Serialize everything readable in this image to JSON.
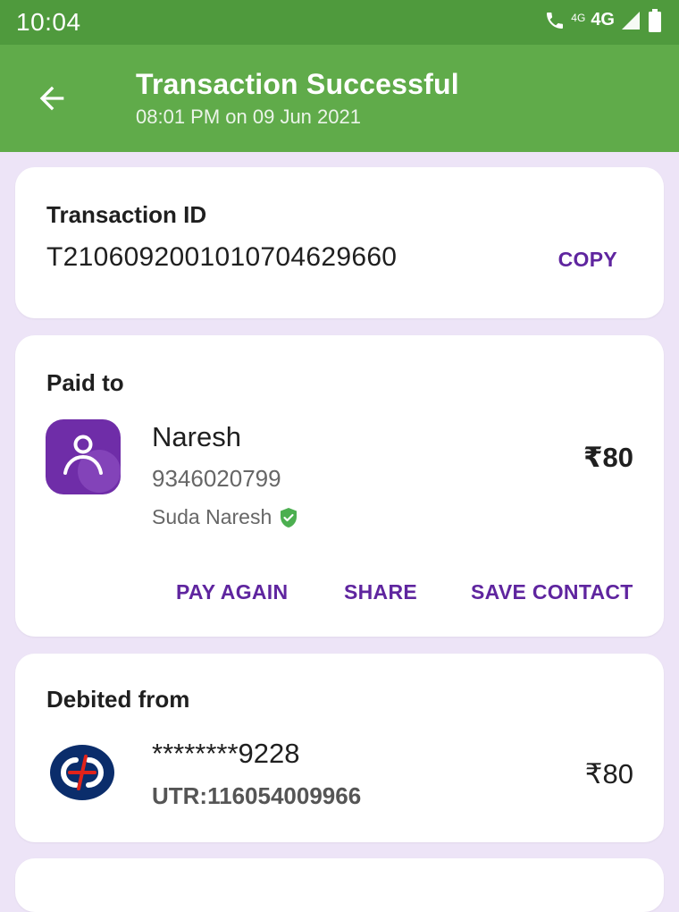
{
  "status_bar": {
    "time": "10:04",
    "network_small": "4G",
    "network": "4G"
  },
  "app_bar": {
    "title": "Transaction Successful",
    "subtitle": "08:01 PM on 09 Jun 2021"
  },
  "transaction": {
    "label": "Transaction ID",
    "id": "T2106092001010704629660",
    "copy_label": "COPY"
  },
  "paid_to": {
    "label": "Paid to",
    "name": "Naresh",
    "phone": "9346020799",
    "holder": "Suda Naresh",
    "amount": "₹80",
    "actions": {
      "pay_again": "PAY AGAIN",
      "share": "SHARE",
      "save_contact": "SAVE CONTACT"
    }
  },
  "debited_from": {
    "label": "Debited from",
    "account": "********9228",
    "utr": "UTR:116054009966",
    "amount": "₹80"
  },
  "colors": {
    "status_bar": "#4f9a3d",
    "app_bar": "#60ab4a",
    "accent": "#5f259f",
    "background": "#ede4f7",
    "verified": "#4caf50",
    "bank_blue": "#0b2d6b",
    "bank_red": "#e2231a"
  },
  "icons": {
    "back": "back-arrow-icon",
    "avatar": "user-avatar-icon",
    "verified": "verified-shield-icon",
    "bank": "kotak-bank-logo"
  }
}
